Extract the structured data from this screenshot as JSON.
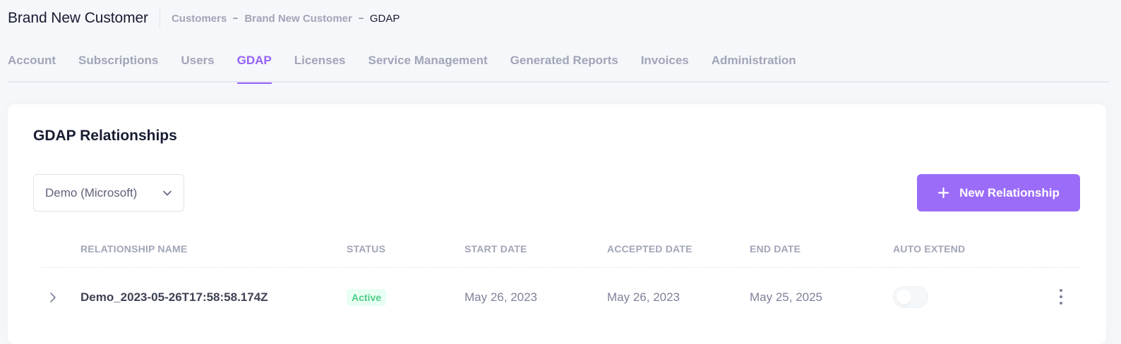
{
  "header": {
    "title": "Brand New Customer",
    "breadcrumb": [
      "Customers",
      "Brand New Customer",
      "GDAP"
    ]
  },
  "tabs": [
    {
      "label": "Account",
      "active": false
    },
    {
      "label": "Subscriptions",
      "active": false
    },
    {
      "label": "Users",
      "active": false
    },
    {
      "label": "GDAP",
      "active": true
    },
    {
      "label": "Licenses",
      "active": false
    },
    {
      "label": "Service Management",
      "active": false
    },
    {
      "label": "Generated Reports",
      "active": false
    },
    {
      "label": "Invoices",
      "active": false
    },
    {
      "label": "Administration",
      "active": false
    }
  ],
  "card": {
    "title": "GDAP Relationships",
    "provider_select": {
      "value": "Demo (Microsoft)",
      "icon": "chevron-down-icon"
    },
    "new_button": {
      "label": "New Relationship",
      "icon": "plus-icon"
    }
  },
  "table": {
    "columns": [
      "RELATIONSHIP NAME",
      "STATUS",
      "START DATE",
      "ACCEPTED DATE",
      "END DATE",
      "AUTO EXTEND"
    ],
    "rows": [
      {
        "name": "Demo_2023-05-26T17:58:58.174Z",
        "status": "Active",
        "start_date": "May 26, 2023",
        "accepted_date": "May 26, 2023",
        "end_date": "May 25, 2025",
        "auto_extend": false
      }
    ]
  },
  "colors": {
    "accent": "#9b6cf8",
    "tab_active": "#9461fa",
    "status_active_text": "#50cd89",
    "status_active_bg": "#e8fff3",
    "muted": "#a1a5b7"
  }
}
